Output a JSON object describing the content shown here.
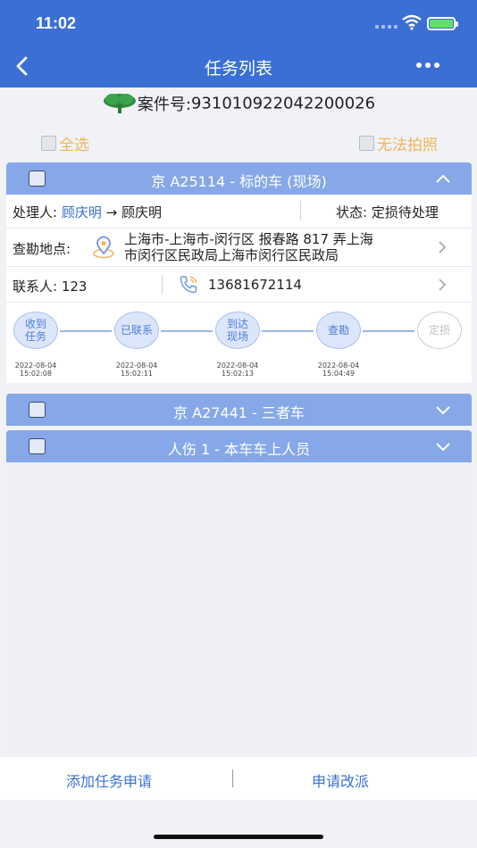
{
  "status_bar": {
    "time": "11:02"
  },
  "nav": {
    "title": "任务列表"
  },
  "case": {
    "label": "案件号:",
    "number": "931010922042200026"
  },
  "select_all": "全选",
  "cannot_photo": "无法拍照",
  "tasks": [
    {
      "title": "京 A25114 - 标的车 (现场)",
      "expanded": true,
      "handler_label": "处理人:",
      "handler_from": "顾庆明",
      "handler_arrow": "→",
      "handler_to": "顾庆明",
      "status_label": "状态:",
      "status_value": "定损待处理",
      "location_label": "查勘地点:",
      "location_line1": "上海市-上海市-闵行区 报春路 817 弄上海",
      "location_line2": "市闵行区民政局上海市闵行区民政局",
      "contact_label": "联系人:",
      "contact_name": "123",
      "phone": "13681672114",
      "steps": [
        {
          "label1": "收到",
          "label2": "任务",
          "date": "2022-08-04",
          "time": "15:02:08",
          "done": true
        },
        {
          "label1": "已联系",
          "label2": "",
          "date": "2022-08-04",
          "time": "15:02:11",
          "done": true
        },
        {
          "label1": "到达",
          "label2": "现场",
          "date": "2022-08-04",
          "time": "15:02:13",
          "done": true
        },
        {
          "label1": "查勘",
          "label2": "",
          "date": "2022-08-04",
          "time": "15:04:49",
          "done": true
        },
        {
          "label1": "定损",
          "label2": "",
          "date": "",
          "time": "",
          "done": false
        }
      ]
    },
    {
      "title": "京 A27441 - 三者车",
      "expanded": false
    },
    {
      "title": "人伤 1 - 本车车上人员",
      "expanded": false
    }
  ],
  "bottom": {
    "add_task": "添加任务申请",
    "reassign": "申请改派"
  },
  "colors": {
    "primary": "#3a6fd4",
    "header": "#86a8e8",
    "accent_orange": "#f0b65a"
  }
}
